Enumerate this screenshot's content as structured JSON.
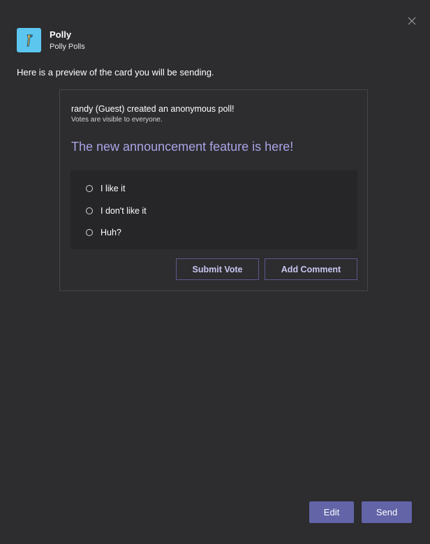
{
  "dialog": {
    "close_icon": "close-icon"
  },
  "app": {
    "icon": "polly-parrot-icon",
    "name": "Polly",
    "subtitle": "Polly Polls"
  },
  "intro_text": "Here is a preview of the card you will be sending.",
  "card": {
    "title": "randy (Guest) created an anonymous poll!",
    "subtitle": "Votes are visible to everyone.",
    "question": "The new announcement feature is here!",
    "choices": [
      {
        "label": "I like it"
      },
      {
        "label": "I don't like it"
      },
      {
        "label": "Huh?"
      }
    ],
    "submit_label": "Submit Vote",
    "comment_label": "Add Comment"
  },
  "footer": {
    "edit_label": "Edit",
    "send_label": "Send"
  },
  "colors": {
    "background": "#2d2c2f",
    "accent": "#6264a7",
    "question": "#a8a5e6",
    "app_icon_bg": "#5cc6ee"
  }
}
